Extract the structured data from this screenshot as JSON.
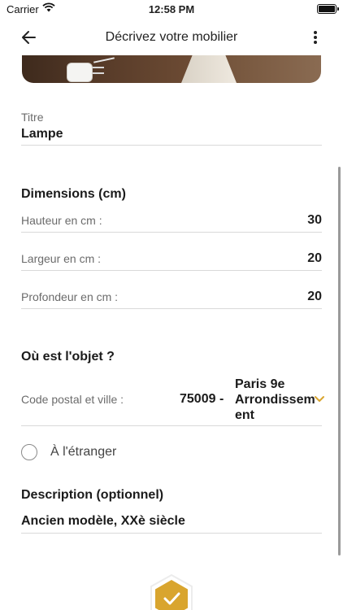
{
  "status_bar": {
    "carrier": "Carrier",
    "time": "12:58 PM"
  },
  "nav": {
    "title": "Décrivez votre mobilier",
    "back_icon": "arrow-left-icon",
    "more_icon": "more-vertical-icon"
  },
  "title_field": {
    "label": "Titre",
    "value": "Lampe"
  },
  "dimensions": {
    "heading": "Dimensions (cm)",
    "rows": [
      {
        "label": "Hauteur en cm :",
        "value": "30"
      },
      {
        "label": "Largeur en cm :",
        "value": "20"
      },
      {
        "label": "Profondeur en cm :",
        "value": "20"
      }
    ]
  },
  "location": {
    "heading": "Où est l'objet ?",
    "label": "Code postal et ville :",
    "postal_code": "75009 -",
    "city_line1": "Paris 9e",
    "city_line2": "Arrondissem",
    "city_line3": "ent",
    "abroad_label": "À l'étranger",
    "abroad_checked": false
  },
  "description": {
    "heading": "Description (optionnel)",
    "value": "Ancien modèle, XXè siècle"
  },
  "colors": {
    "accent": "#D9A52E",
    "divider": "#D9D9D9"
  },
  "submit": {
    "icon": "check-icon"
  }
}
